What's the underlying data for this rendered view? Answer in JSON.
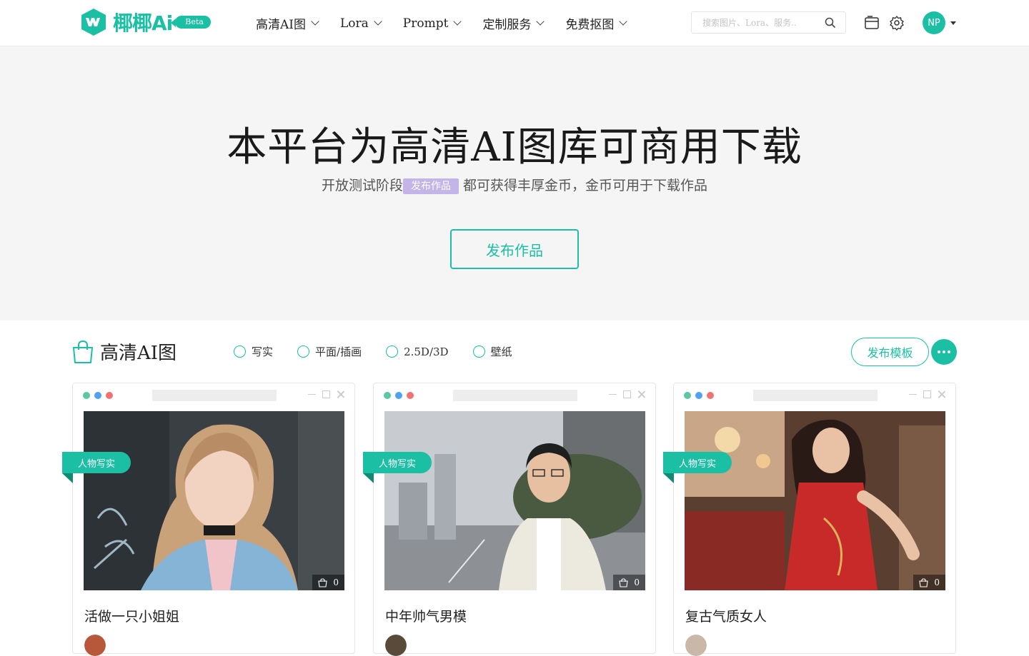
{
  "brand": {
    "name": "椰椰Ai",
    "badge": "Beta",
    "color": "#1bbfa4"
  },
  "nav": [
    {
      "label": "高清AI图"
    },
    {
      "label": "Lora"
    },
    {
      "label": "Prompt"
    },
    {
      "label": "定制服务"
    },
    {
      "label": "免费抠图"
    }
  ],
  "search": {
    "placeholder": "搜索图片、Lora、服务..",
    "value": ""
  },
  "user": {
    "initials": "NP"
  },
  "hero": {
    "title": "本平台为高清AI图库可商用下载",
    "sub_before": "开放测试阶段",
    "sub_tag": "发布作品",
    "sub_after": "都可获得丰厚金币，金币可用于下载作品",
    "button": "发布作品"
  },
  "section": {
    "title": "高清AI图",
    "filters": [
      "写实",
      "平面/插画",
      "2.5D/3D",
      "壁纸"
    ],
    "publish_template": "发布模板"
  },
  "cards": [
    {
      "category": "人物写实",
      "title": "活做一只小姐姐",
      "purchases": "0",
      "image": "woman-portrait-with-braid"
    },
    {
      "category": "人物写实",
      "title": "中年帅气男模",
      "purchases": "0",
      "image": "man-in-white-jacket-on-street"
    },
    {
      "category": "人物写实",
      "title": "复古气质女人",
      "purchases": "0",
      "image": "woman-in-red-dress-restaurant"
    }
  ],
  "icons": [
    "search-icon",
    "folder-icon",
    "gear-icon",
    "shirt-icon",
    "shopping-bag-icon",
    "more-icon"
  ]
}
